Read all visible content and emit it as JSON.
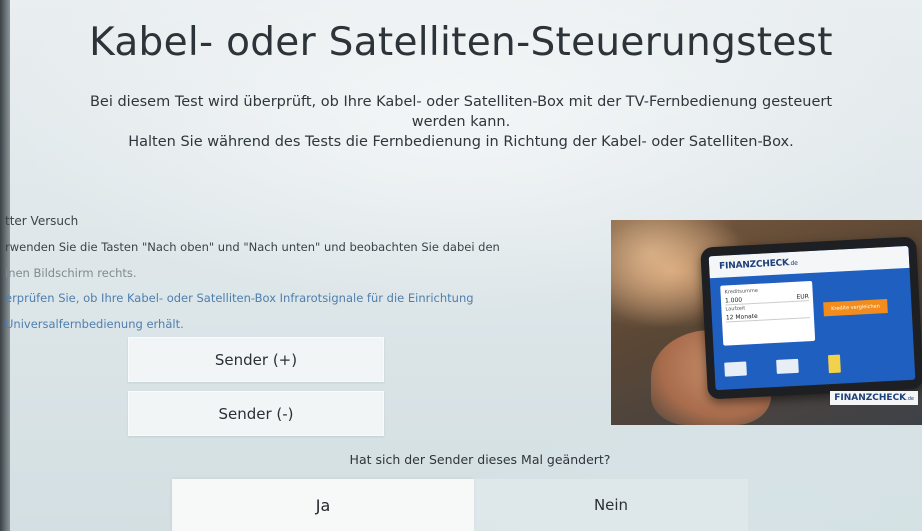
{
  "title": "Kabel- oder Satelliten-Steuerungstest",
  "description": {
    "line1": "Bei diesem Test wird überprüft, ob Ihre Kabel- oder Satelliten-Box mit der TV-Fernbedienung gesteuert",
    "line2": "werden kann.",
    "line3": "Halten Sie während des Tests die Fernbedienung in Richtung der Kabel- oder Satelliten-Box."
  },
  "steps": {
    "title": "tter Versuch",
    "line1": "rwenden Sie die Tasten \"Nach oben\" und \"Nach unten\" und beobachten Sie dabei den",
    "line2": "inen Bildschirm rechts.",
    "line3": "erprüfen Sie, ob Ihre Kabel- oder Satelliten-Box Infrarotsignale für die Einrichtung",
    "line4": "Universalfernbedienung erhält."
  },
  "buttons": {
    "channel_up": "Sender (+)",
    "channel_down": "Sender (-)"
  },
  "question": "Hat sich der Sender dieses Mal geändert?",
  "answers": {
    "yes": "Ja",
    "no": "Nein"
  },
  "illustration": {
    "screen_brand": "FINANZCHECK",
    "screen_brand_suffix": ".de",
    "form_label1": "Kreditsumme",
    "form_value1": "1.000",
    "form_unit1": "EUR",
    "form_label2": "Laufzeit",
    "form_value2": "12 Monate",
    "cta_label": "Kredite vergleichen",
    "corner_brand": "FINANZCHECK",
    "corner_brand_suffix": ".de"
  },
  "colors": {
    "background": "#e3eaed",
    "button_bg": "#f4f6f6",
    "text": "#2b3036",
    "link_blue": "#4f7fae"
  }
}
